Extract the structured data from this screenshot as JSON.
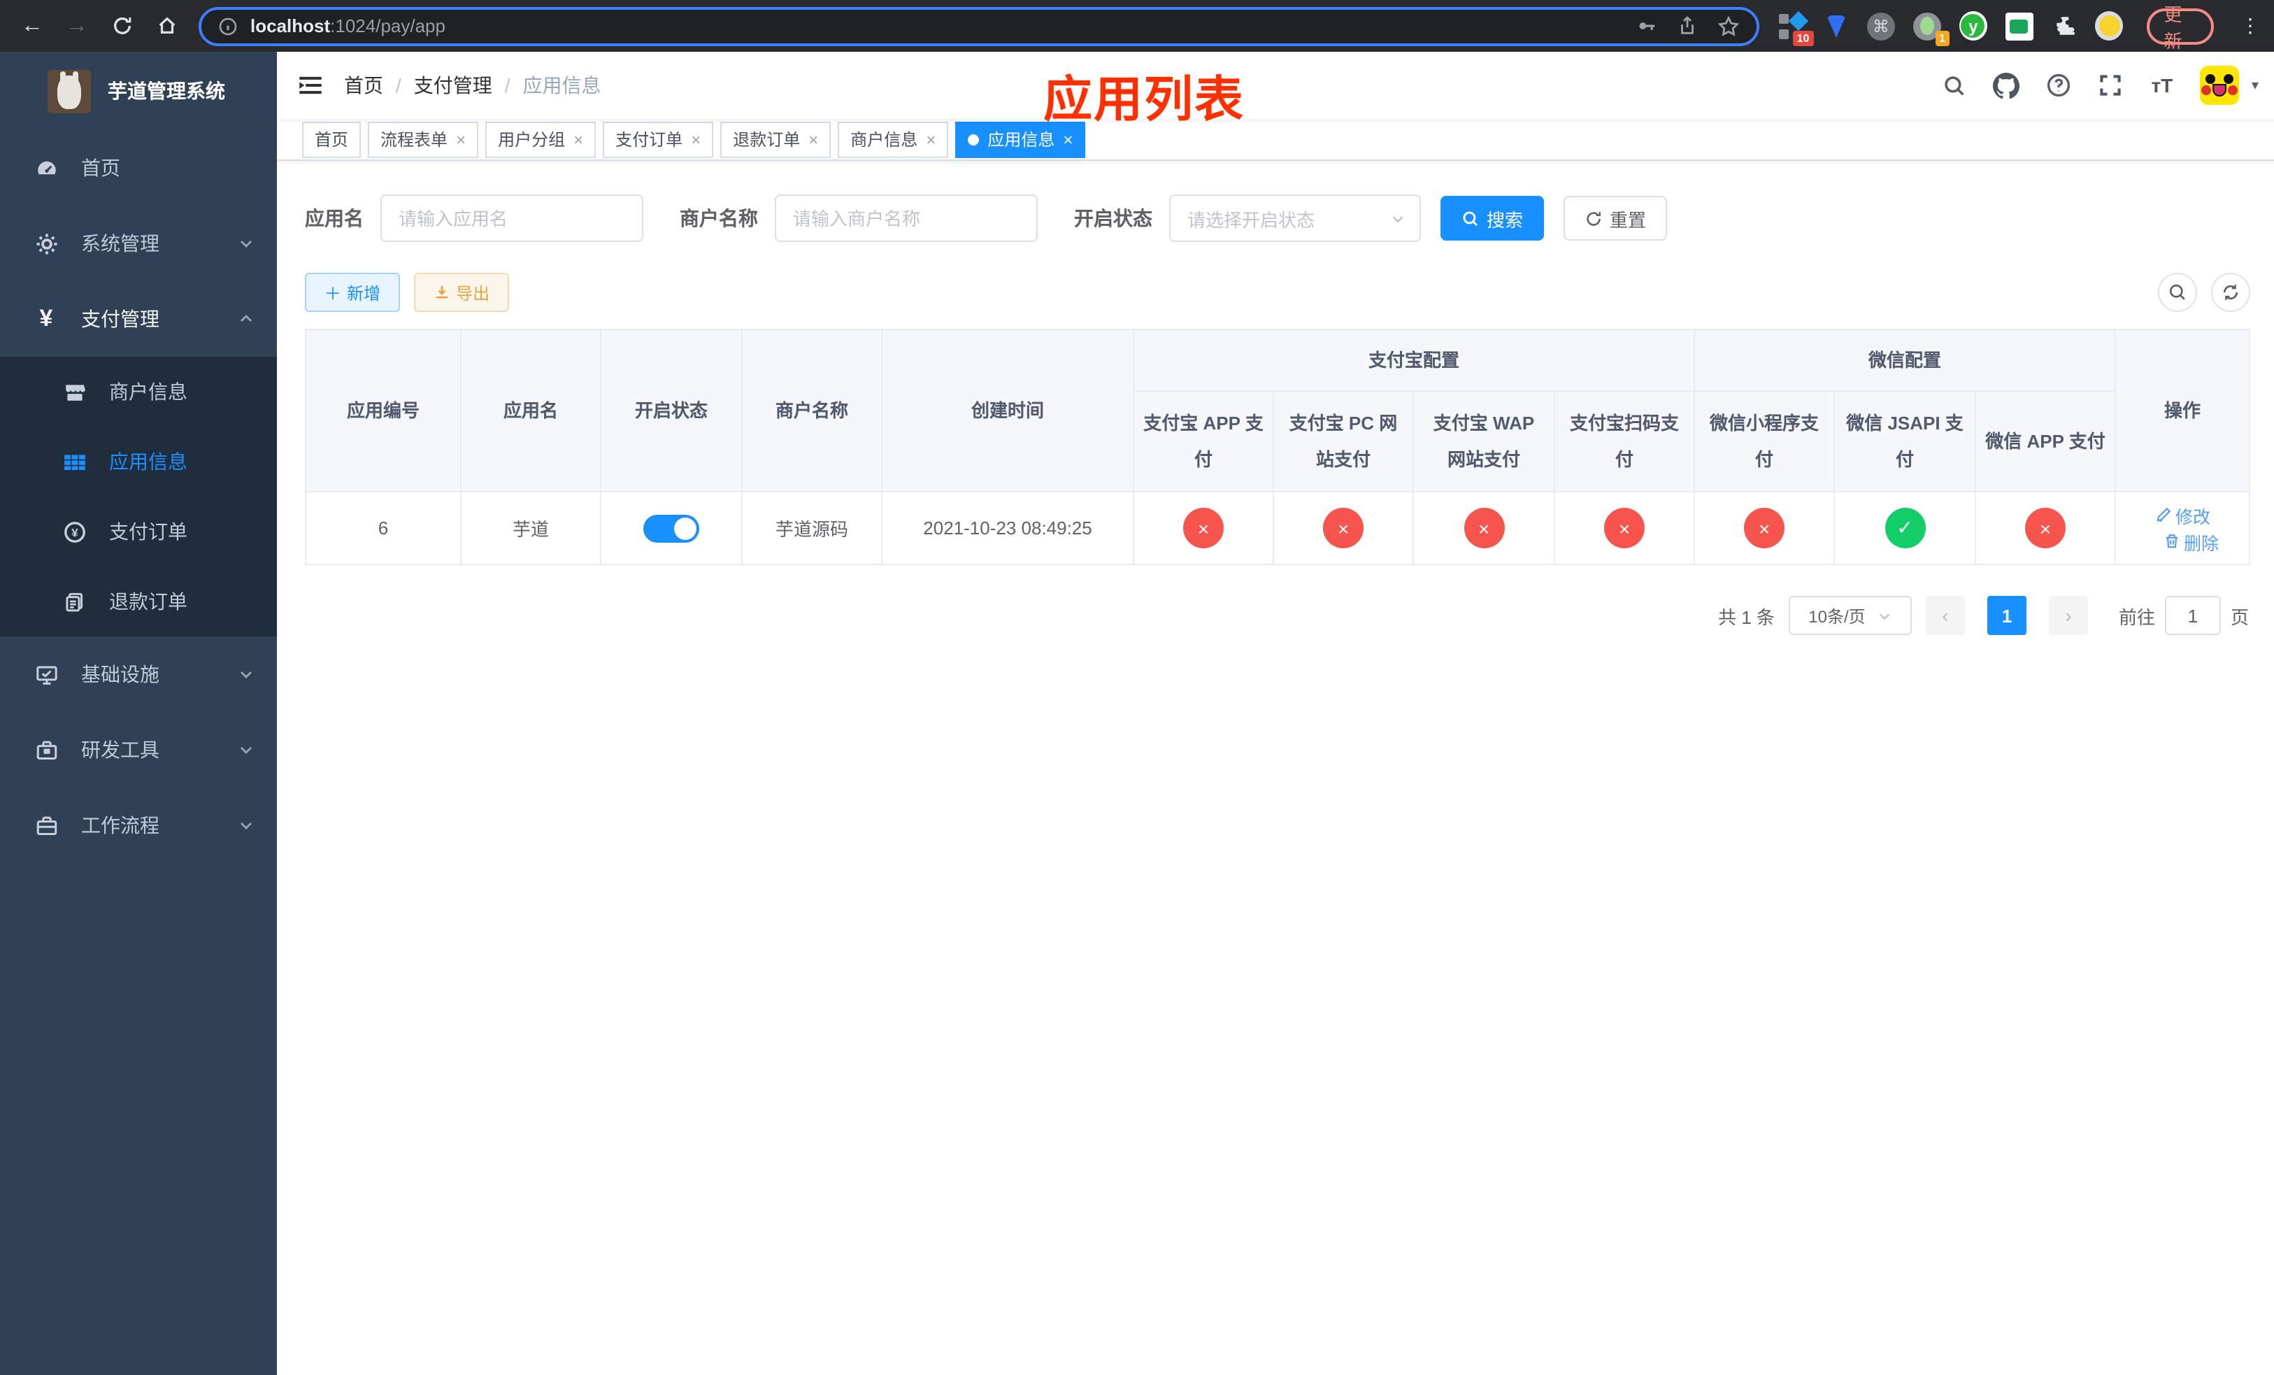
{
  "browser": {
    "url": {
      "host": "localhost",
      "rest": ":1024/pay/app"
    },
    "update_label": "更新",
    "ext_badge_grid": "10",
    "ext_badge_tray": "1",
    "ext_y_letter": "y",
    "ext_cmd_glyph": "⌘"
  },
  "icons": {
    "back": "←",
    "forward": "→",
    "close": "×",
    "prev": "‹",
    "next": "›",
    "kebab": "⋮",
    "caret": "▾",
    "plus": "＋"
  },
  "sidebar": {
    "title": "芋道管理系统",
    "menu": [
      {
        "label": "首页"
      },
      {
        "label": "系统管理"
      },
      {
        "label": "支付管理"
      },
      {
        "label": "商户信息"
      },
      {
        "label": "应用信息"
      },
      {
        "label": "支付订单"
      },
      {
        "label": "退款订单"
      },
      {
        "label": "基础设施"
      },
      {
        "label": "研发工具"
      },
      {
        "label": "工作流程"
      }
    ]
  },
  "header": {
    "breadcrumb": [
      "首页",
      "支付管理",
      "应用信息"
    ],
    "overlay_title": "应用列表"
  },
  "tabs": [
    {
      "label": "首页"
    },
    {
      "label": "流程表单"
    },
    {
      "label": "用户分组"
    },
    {
      "label": "支付订单"
    },
    {
      "label": "退款订单"
    },
    {
      "label": "商户信息"
    },
    {
      "label": "应用信息"
    }
  ],
  "filters": {
    "app_name_label": "应用名",
    "app_name_placeholder": "请输入应用名",
    "merchant_label": "商户名称",
    "merchant_placeholder": "请输入商户名称",
    "status_label": "开启状态",
    "status_placeholder": "请选择开启状态",
    "search_label": "搜索",
    "reset_label": "重置"
  },
  "toolbar": {
    "add_label": "新增",
    "export_label": "导出"
  },
  "table": {
    "columns": [
      "应用编号",
      "应用名",
      "开启状态",
      "商户名称",
      "创建时间"
    ],
    "group_alipay": "支付宝配置",
    "group_wechat": "微信配置",
    "col_actions": "操作",
    "sub_columns": [
      "支付宝 APP 支付",
      "支付宝 PC 网站支付",
      "支付宝 WAP 网站支付",
      "支付宝扫码支付",
      "微信小程序支付",
      "微信 JSAPI 支付",
      "微信 APP 支付"
    ],
    "row": {
      "id": "6",
      "name": "芋道",
      "enabled": true,
      "toggle_class": "switch on",
      "merchant": "芋道源码",
      "created_at": "2021-10-23 08:49:25",
      "config_classes": [
        "status-icon no",
        "status-icon no",
        "status-icon no",
        "status-icon no",
        "status-icon no",
        "status-icon yes",
        "status-icon no"
      ],
      "config_glyphs": [
        "×",
        "×",
        "×",
        "×",
        "×",
        "✓",
        "×"
      ],
      "edit_label": "修改",
      "delete_label": "删除"
    }
  },
  "pagination": {
    "total_text": "共 1 条",
    "page_size": "10条/页",
    "current_page": "1",
    "goto_label": "前往",
    "goto_value": "1",
    "page_suffix": "页"
  },
  "colors": {
    "primary": "#1890ff",
    "danger": "#f7544d",
    "success": "#13ce66",
    "warning": "#e6a23c",
    "title_red": "#ff2f00",
    "sidebar_bg": "#304156",
    "submenu_bg": "#1f2d3d"
  }
}
